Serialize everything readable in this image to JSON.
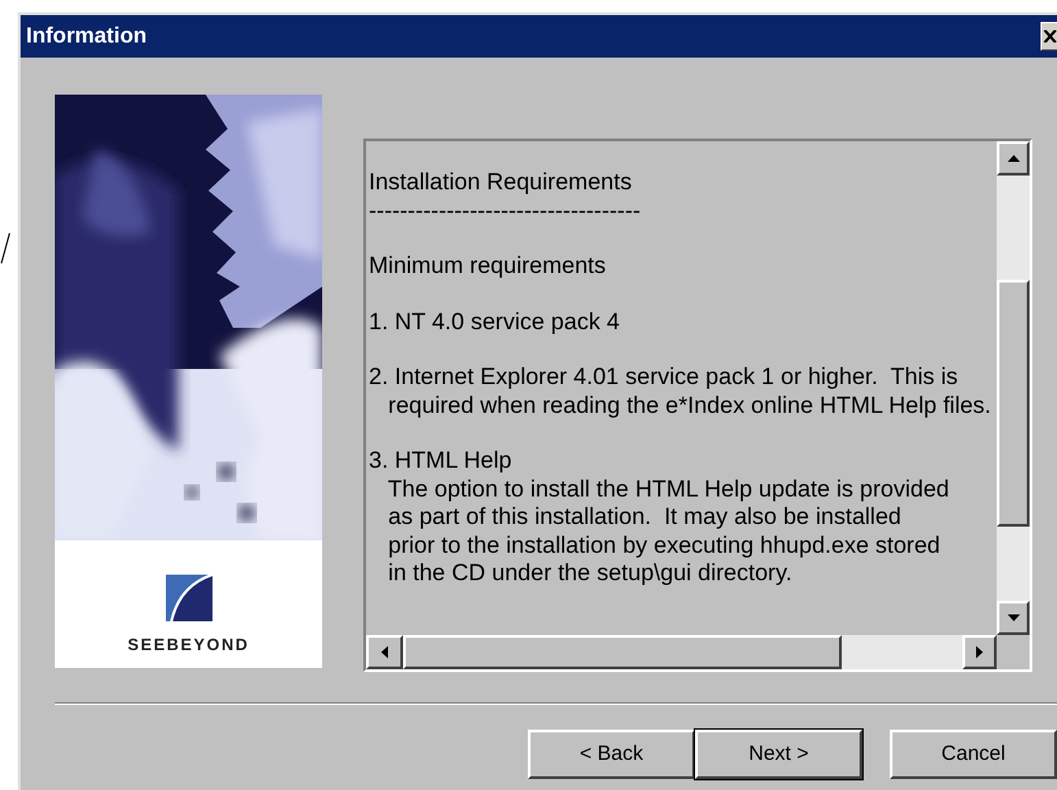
{
  "window": {
    "title": "Information"
  },
  "logo": {
    "text": "SEEBEYOND"
  },
  "text_box": {
    "paragraphs": [
      "Installation Requirements\n-----------------------------------",
      "Minimum requirements",
      "1. NT 4.0 service pack 4",
      "2. Internet Explorer 4.01 service pack 1 or higher.  This is\n   required when reading the e*Index online HTML Help files.",
      "3. HTML Help\n   The option to install the HTML Help update is provided\n   as part of this installation.  It may also be installed\n   prior to the installation by executing hhupd.exe stored\n   in the CD under the setup\\gui directory."
    ]
  },
  "buttons": [
    {
      "label": "< Back",
      "default": false
    },
    {
      "label": "Next >",
      "default": true
    },
    {
      "label": "Cancel",
      "default": false
    }
  ]
}
